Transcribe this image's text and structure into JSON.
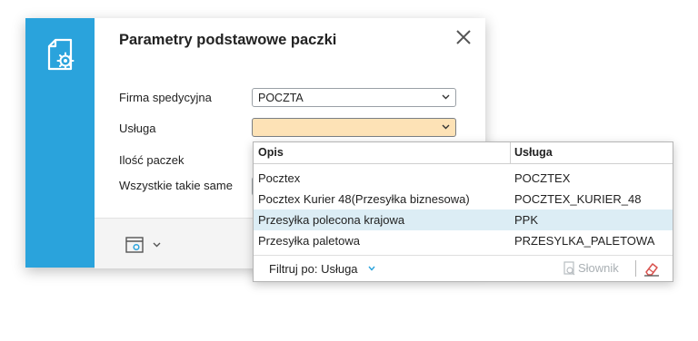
{
  "dialog": {
    "title": "Parametry podstawowe paczki",
    "fields": {
      "carrier_label": "Firma spedycyjna",
      "carrier_value": "POCZTA",
      "service_label": "Usługa",
      "service_value": "",
      "packages_label": "Ilość paczek",
      "all_same_label": "Wszystkie takie same"
    }
  },
  "dropdown": {
    "headers": {
      "description": "Opis",
      "service": "Usługa"
    },
    "rows": [
      {
        "description": "Pocztex",
        "service": "POCZTEX"
      },
      {
        "description": "Pocztex Kurier 48(Przesyłka biznesowa)",
        "service": "POCZTEX_KURIER_48"
      },
      {
        "description": "Przesyłka polecona krajowa",
        "service": "PPK"
      },
      {
        "description": "Przesyłka paletowa",
        "service": "PRZESYLKA_PALETOWA"
      }
    ],
    "highlighted_row": 2,
    "filter_label": "Filtruj po: Usługa",
    "dictionary_label": "Słownik"
  },
  "colors": {
    "accent": "#2aa3dc",
    "active_field": "#fde2b6",
    "row_highlight": "#dcedf5"
  },
  "icons": [
    "document-settings-icon",
    "close-icon",
    "chevron-down-icon",
    "window-settings-icon",
    "dictionary-search-icon",
    "eraser-icon"
  ]
}
